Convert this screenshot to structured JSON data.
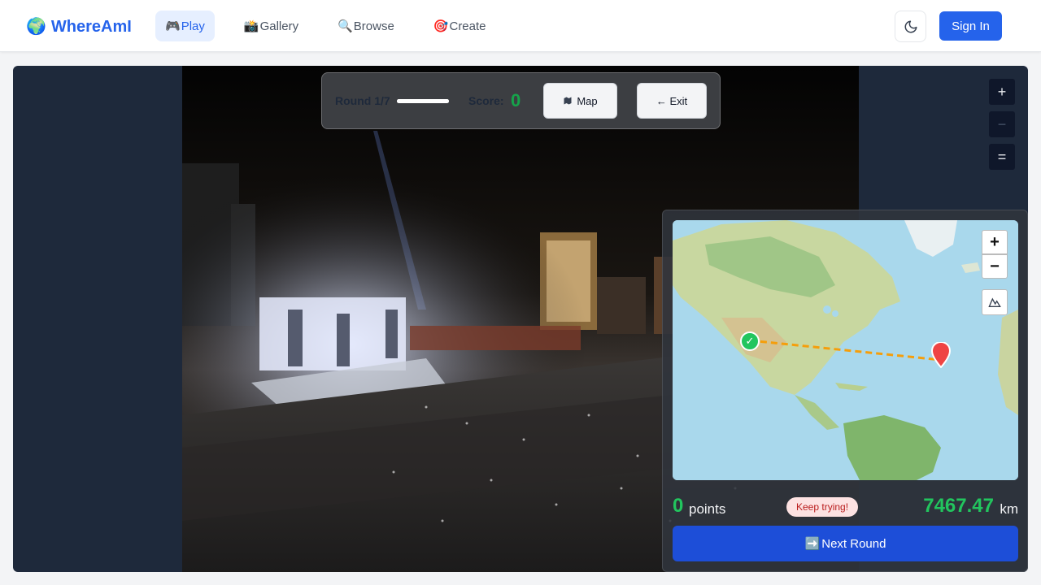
{
  "header": {
    "brand": {
      "icon": "globe-icon",
      "name": "WhereAmI"
    },
    "nav": [
      {
        "label": "Play",
        "icon": "🎮",
        "active": true
      },
      {
        "label": "Gallery",
        "icon": "📸",
        "active": false
      },
      {
        "label": "Browse",
        "icon": "🔍",
        "active": false
      },
      {
        "label": "Create",
        "icon": "🎯",
        "active": false
      }
    ],
    "theme_toggle_icon": "moon-icon",
    "sign_in_label": "Sign In"
  },
  "hud": {
    "round_label": "Round 1/7",
    "round_progress": 1.0,
    "score_label": "Score:",
    "score_value": "0",
    "map_button": "Map",
    "exit_button": "← Exit"
  },
  "viewer_controls": {
    "zoom_in": "+",
    "zoom_out": "−",
    "reset": "="
  },
  "result": {
    "map_zoom_in": "+",
    "map_zoom_out": "−",
    "points_value": "0",
    "points_label": "points",
    "feedback_badge": "Keep trying!",
    "distance_value": "7467.47",
    "distance_unit": "km",
    "next_button": "Next Round",
    "next_button_icon": "➡️"
  },
  "colors": {
    "accent": "#2563eb",
    "score_green": "#16a34a",
    "guess_marker": "#ef4444",
    "actual_marker": "#22c55e",
    "distance_line": "#f59e0b"
  }
}
